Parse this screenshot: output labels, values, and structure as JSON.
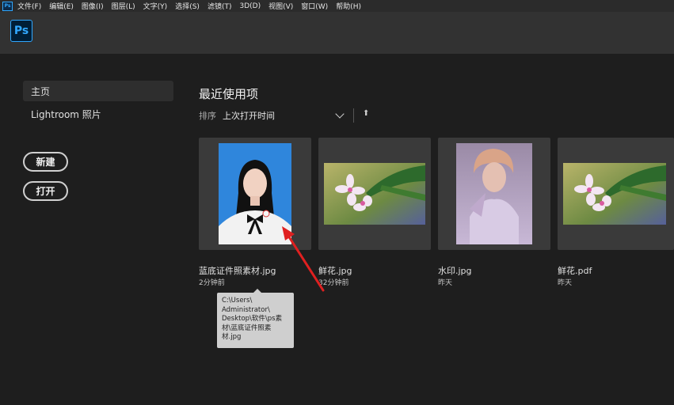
{
  "menubar": {
    "items": [
      "文件(F)",
      "编辑(E)",
      "图像(I)",
      "图层(L)",
      "文字(Y)",
      "选择(S)",
      "滤镜(T)",
      "3D(D)",
      "视图(V)",
      "窗口(W)",
      "帮助(H)"
    ]
  },
  "header": {
    "logo": "Ps"
  },
  "sidebar": {
    "home": "主页",
    "lightroom": "Lightroom 照片",
    "new_button": "新建",
    "open_button": "打开"
  },
  "recent": {
    "title": "最近使用项",
    "sort_label": "排序",
    "sort_value": "上次打开时间",
    "files": [
      {
        "name": "蓝底证件照素材.jpg",
        "time": "2分钟前"
      },
      {
        "name": "鲜花.jpg",
        "time": "32分钟前"
      },
      {
        "name": "水印.jpg",
        "time": "昨天"
      },
      {
        "name": "鲜花.pdf",
        "time": "昨天"
      }
    ]
  },
  "tooltip": {
    "lines": [
      "C:\\Users\\",
      "Administrator\\",
      "Desktop\\软件\\ps素",
      "材\\蓝底证件照素",
      "材.jpg"
    ]
  },
  "colors": {
    "accent": "#31a8ff",
    "annotation_arrow": "#e02020"
  }
}
